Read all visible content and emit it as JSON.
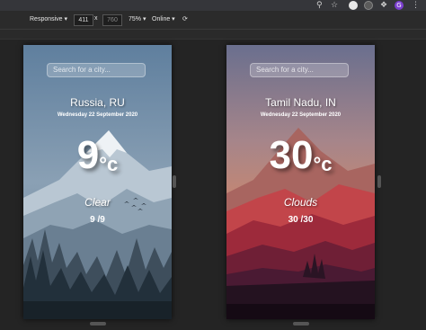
{
  "browser": {
    "icons": [
      "search-icon",
      "star-icon",
      "extension-icon",
      "puzzle-icon",
      "avatar",
      "menu-icon"
    ],
    "avatar_letter": "G"
  },
  "devtools": {
    "device": "Responsive",
    "width": "411",
    "times": "x",
    "height": "760",
    "zoom": "75%",
    "throttle": "Online"
  },
  "panels": [
    {
      "search_placeholder": "Search for a city...",
      "location": "Russia, RU",
      "date": "Wednesday 22 September 2020",
      "temp": "9",
      "unit": "°c",
      "condition": "Clear",
      "minmax": "9 /9"
    },
    {
      "search_placeholder": "Search for a city...",
      "location": "Tamil Nadu, IN",
      "date": "Wednesday 22 September 2020",
      "temp": "30",
      "unit": "°c",
      "condition": "Clouds",
      "minmax": "30 /30"
    }
  ]
}
